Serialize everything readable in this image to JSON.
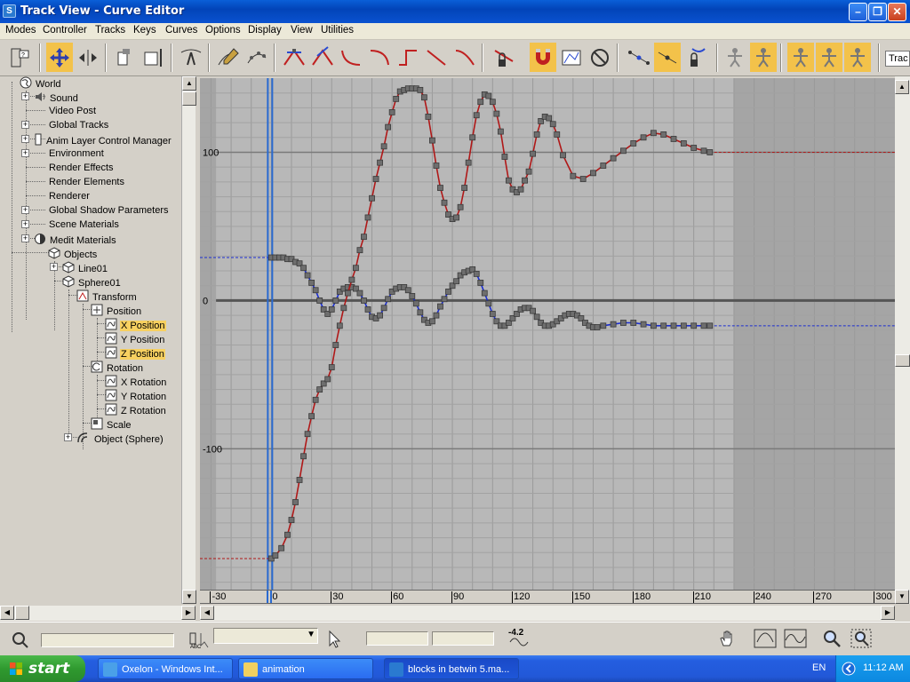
{
  "window": {
    "title": "Track View - Curve Editor",
    "app_icon": "3ds-max-icon",
    "controls": [
      "minimize-icon",
      "restore-icon",
      "close-icon"
    ]
  },
  "menu": [
    "Modes",
    "Controller",
    "Tracks",
    "Keys",
    "Curves",
    "Options",
    "Display",
    "View",
    "Utilities"
  ],
  "toolbar": {
    "track_field": "Trac"
  },
  "tree": [
    {
      "label": "World",
      "icon": "world-icon"
    },
    {
      "label": "Sound",
      "icon": "sound-icon"
    },
    {
      "label": "Video Post",
      "icon": "none"
    },
    {
      "label": "Global Tracks",
      "icon": "none"
    },
    {
      "label": "Anim Layer Control Manager",
      "icon": "layer-icon"
    },
    {
      "label": "Environment",
      "icon": "none"
    },
    {
      "label": "Render Effects",
      "icon": "none"
    },
    {
      "label": "Render Elements",
      "icon": "none"
    },
    {
      "label": "Renderer",
      "icon": "none"
    },
    {
      "label": "Global Shadow Parameters",
      "icon": "none"
    },
    {
      "label": "Scene Materials",
      "icon": "none"
    },
    {
      "label": "Medit Materials",
      "icon": "material-icon"
    },
    {
      "label": "Objects",
      "icon": "object-icon"
    },
    {
      "label": "Line01",
      "icon": "object-icon"
    },
    {
      "label": "Sphere01",
      "icon": "object-icon"
    },
    {
      "label": "Transform",
      "icon": "transform-icon"
    },
    {
      "label": "Position",
      "icon": "position-icon"
    },
    {
      "label": "X Position",
      "icon": "curve-icon",
      "selected": true
    },
    {
      "label": "Y Position",
      "icon": "curve-icon"
    },
    {
      "label": "Z Position",
      "icon": "curve-icon",
      "selected": true
    },
    {
      "label": "Rotation",
      "icon": "rotation-icon"
    },
    {
      "label": "X Rotation",
      "icon": "curve-icon"
    },
    {
      "label": "Y Rotation",
      "icon": "curve-icon"
    },
    {
      "label": "Z Rotation",
      "icon": "curve-icon"
    },
    {
      "label": "Scale",
      "icon": "scale-icon"
    },
    {
      "label": "Object (Sphere)",
      "icon": "sphere-object-icon"
    }
  ],
  "graph": {
    "y_labels": [
      "100",
      "0",
      "-100"
    ],
    "ruler_labels": [
      "-30",
      "0",
      "30",
      "60",
      "90",
      "120",
      "150",
      "180",
      "210",
      "240",
      "270",
      "300"
    ],
    "current_frame": 0,
    "x_curve_color": "#b01818",
    "z_curve_color": "#1c2ed0",
    "x_position_keys": [
      [
        0,
        -174
      ],
      [
        2,
        -172
      ],
      [
        5,
        -167
      ],
      [
        8,
        -158
      ],
      [
        10,
        -148
      ],
      [
        12,
        -136
      ],
      [
        14,
        -121
      ],
      [
        16,
        -105
      ],
      [
        18,
        -90
      ],
      [
        20,
        -78
      ],
      [
        22,
        -67
      ],
      [
        24,
        -60
      ],
      [
        26,
        -56
      ],
      [
        28,
        -53
      ],
      [
        30,
        -45
      ],
      [
        32,
        -30
      ],
      [
        34,
        -17
      ],
      [
        36,
        -5
      ],
      [
        38,
        5
      ],
      [
        40,
        14
      ],
      [
        42,
        22
      ],
      [
        44,
        34
      ],
      [
        46,
        43
      ],
      [
        48,
        56
      ],
      [
        50,
        69
      ],
      [
        52,
        82
      ],
      [
        54,
        93
      ],
      [
        56,
        104
      ],
      [
        58,
        117
      ],
      [
        60,
        127
      ],
      [
        62,
        136
      ],
      [
        64,
        141
      ],
      [
        66,
        142
      ],
      [
        68,
        143
      ],
      [
        70,
        143
      ],
      [
        72,
        143
      ],
      [
        74,
        142
      ],
      [
        76,
        137
      ],
      [
        78,
        124
      ],
      [
        80,
        108
      ],
      [
        82,
        91
      ],
      [
        84,
        76
      ],
      [
        86,
        66
      ],
      [
        88,
        58
      ],
      [
        90,
        55
      ],
      [
        92,
        56
      ],
      [
        94,
        63
      ],
      [
        96,
        76
      ],
      [
        98,
        93
      ],
      [
        100,
        110
      ],
      [
        102,
        125
      ],
      [
        104,
        134
      ],
      [
        106,
        139
      ],
      [
        108,
        138
      ],
      [
        110,
        134
      ],
      [
        112,
        126
      ],
      [
        114,
        114
      ],
      [
        116,
        97
      ],
      [
        118,
        81
      ],
      [
        120,
        75
      ],
      [
        122,
        73
      ],
      [
        124,
        75
      ],
      [
        126,
        81
      ],
      [
        128,
        87
      ],
      [
        130,
        99
      ],
      [
        132,
        112
      ],
      [
        134,
        121
      ],
      [
        136,
        124
      ],
      [
        138,
        123
      ],
      [
        140,
        119
      ],
      [
        142,
        112
      ],
      [
        145,
        98
      ],
      [
        150,
        84
      ],
      [
        155,
        82
      ],
      [
        160,
        86
      ],
      [
        165,
        91
      ],
      [
        170,
        96
      ],
      [
        175,
        101
      ],
      [
        180,
        106
      ],
      [
        185,
        110
      ],
      [
        190,
        113
      ],
      [
        195,
        112
      ],
      [
        200,
        109
      ],
      [
        205,
        106
      ],
      [
        210,
        103
      ],
      [
        215,
        101
      ],
      [
        218,
        100
      ]
    ],
    "x_position_after": 100,
    "x_position_before": -174,
    "z_position_keys": [
      [
        0,
        29
      ],
      [
        2,
        29
      ],
      [
        4,
        29
      ],
      [
        6,
        29
      ],
      [
        8,
        28
      ],
      [
        10,
        28
      ],
      [
        12,
        26
      ],
      [
        14,
        25
      ],
      [
        16,
        22
      ],
      [
        18,
        17
      ],
      [
        20,
        12
      ],
      [
        22,
        7
      ],
      [
        24,
        0
      ],
      [
        26,
        -6
      ],
      [
        28,
        -9
      ],
      [
        30,
        -6
      ],
      [
        32,
        0
      ],
      [
        34,
        6
      ],
      [
        36,
        8
      ],
      [
        38,
        9
      ],
      [
        40,
        9
      ],
      [
        42,
        8
      ],
      [
        44,
        5
      ],
      [
        46,
        0
      ],
      [
        48,
        -6
      ],
      [
        50,
        -11
      ],
      [
        52,
        -12
      ],
      [
        54,
        -10
      ],
      [
        56,
        -5
      ],
      [
        58,
        1
      ],
      [
        60,
        6
      ],
      [
        62,
        8
      ],
      [
        64,
        9
      ],
      [
        66,
        9
      ],
      [
        68,
        7
      ],
      [
        70,
        3
      ],
      [
        72,
        -2
      ],
      [
        74,
        -8
      ],
      [
        76,
        -13
      ],
      [
        78,
        -15
      ],
      [
        80,
        -14
      ],
      [
        82,
        -10
      ],
      [
        84,
        -4
      ],
      [
        86,
        1
      ],
      [
        88,
        6
      ],
      [
        90,
        10
      ],
      [
        92,
        13
      ],
      [
        94,
        17
      ],
      [
        96,
        19
      ],
      [
        98,
        20
      ],
      [
        100,
        21
      ],
      [
        102,
        18
      ],
      [
        104,
        12
      ],
      [
        106,
        5
      ],
      [
        108,
        -2
      ],
      [
        110,
        -9
      ],
      [
        112,
        -14
      ],
      [
        114,
        -17
      ],
      [
        116,
        -17
      ],
      [
        118,
        -15
      ],
      [
        120,
        -12
      ],
      [
        122,
        -9
      ],
      [
        124,
        -6
      ],
      [
        126,
        -5
      ],
      [
        128,
        -5
      ],
      [
        130,
        -7
      ],
      [
        132,
        -11
      ],
      [
        134,
        -15
      ],
      [
        136,
        -17
      ],
      [
        138,
        -17
      ],
      [
        140,
        -16
      ],
      [
        142,
        -14
      ],
      [
        144,
        -12
      ],
      [
        146,
        -10
      ],
      [
        148,
        -9
      ],
      [
        150,
        -9
      ],
      [
        152,
        -10
      ],
      [
        154,
        -12
      ],
      [
        156,
        -15
      ],
      [
        158,
        -17
      ],
      [
        160,
        -18
      ],
      [
        162,
        -18
      ],
      [
        165,
        -17
      ],
      [
        170,
        -16
      ],
      [
        175,
        -15
      ],
      [
        180,
        -15
      ],
      [
        185,
        -16
      ],
      [
        190,
        -17
      ],
      [
        195,
        -17
      ],
      [
        200,
        -17
      ],
      [
        205,
        -17
      ],
      [
        210,
        -17
      ],
      [
        215,
        -17
      ],
      [
        218,
        -17
      ]
    ],
    "z_position_after": -17,
    "z_position_before": 29,
    "x_range": [
      -30,
      310
    ],
    "y_range": [
      -195,
      150
    ],
    "active_range": [
      0,
      230
    ]
  },
  "status": {
    "value_readout": "-4.2"
  },
  "taskbar": {
    "start_label": "start",
    "tasks": [
      {
        "label": "Oxelon - Windows Int...",
        "icon": "ie-icon"
      },
      {
        "label": "animation",
        "icon": "folder-icon"
      },
      {
        "label": "blocks in betwin 5.ma...",
        "icon": "3ds-max-icon",
        "active": true
      }
    ],
    "language": "EN",
    "clock": "11:12 AM"
  }
}
